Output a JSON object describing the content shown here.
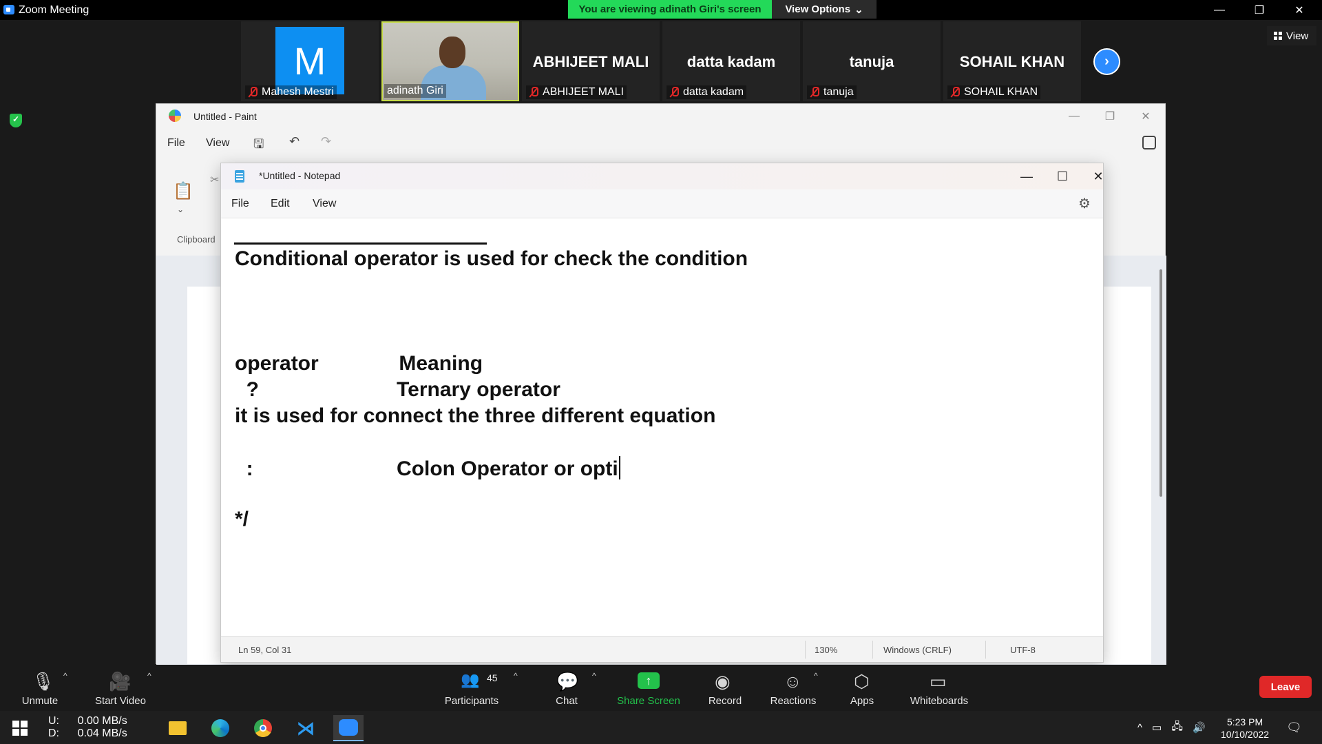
{
  "zoom": {
    "window_title": "Zoom Meeting",
    "viewing_banner": "You are viewing adinath Giri's screen",
    "view_options": "View Options",
    "view_button": "View",
    "participants": [
      {
        "big_name": "",
        "label": "Mahesh Mestri",
        "avatar_letter": "M"
      },
      {
        "big_name": "",
        "label": "adinath Giri"
      },
      {
        "big_name": "ABHIJEET MALI",
        "label": "ABHIJEET MALI"
      },
      {
        "big_name": "datta kadam",
        "label": "datta kadam"
      },
      {
        "big_name": "tanuja",
        "label": "tanuja"
      },
      {
        "big_name": "SOHAIL KHAN",
        "label": "SOHAIL KHAN"
      }
    ],
    "toolbar": {
      "unmute": "Unmute",
      "start_video": "Start Video",
      "participants": "Participants",
      "participant_count": "45",
      "chat": "Chat",
      "share_screen": "Share Screen",
      "record": "Record",
      "reactions": "Reactions",
      "apps": "Apps",
      "whiteboards": "Whiteboards",
      "leave": "Leave"
    },
    "colors": {
      "accent": "#2d8cff",
      "share_green": "#23c24b",
      "leave_red": "#e02828",
      "banner_green": "#23d959"
    }
  },
  "paint": {
    "title": "Untitled - Paint",
    "menu": [
      "File",
      "View"
    ],
    "clipboard_label": "Clipboard"
  },
  "notepad": {
    "title": "*Untitled - Notepad",
    "menu": [
      "File",
      "Edit",
      "View"
    ],
    "lines": [
      "Conditional operator is used for check the condition",
      "operator              Meaning",
      "  ?                        Ternary operator",
      "it is used for connect the three different equation",
      "  :                         Colon Operator or opti",
      "*/"
    ],
    "status": {
      "position": "Ln 59, Col 31",
      "zoom": "130%",
      "line_ending": "Windows (CRLF)",
      "encoding": "UTF-8"
    }
  },
  "taskbar": {
    "net_stats": "U:      0.00 MB/s\nD:      0.04 MB/s",
    "time": "5:23 PM",
    "date": "10/10/2022",
    "apps": [
      "file-explorer-icon",
      "edge-icon",
      "chrome-icon",
      "vscode-icon",
      "zoom-icon"
    ]
  }
}
